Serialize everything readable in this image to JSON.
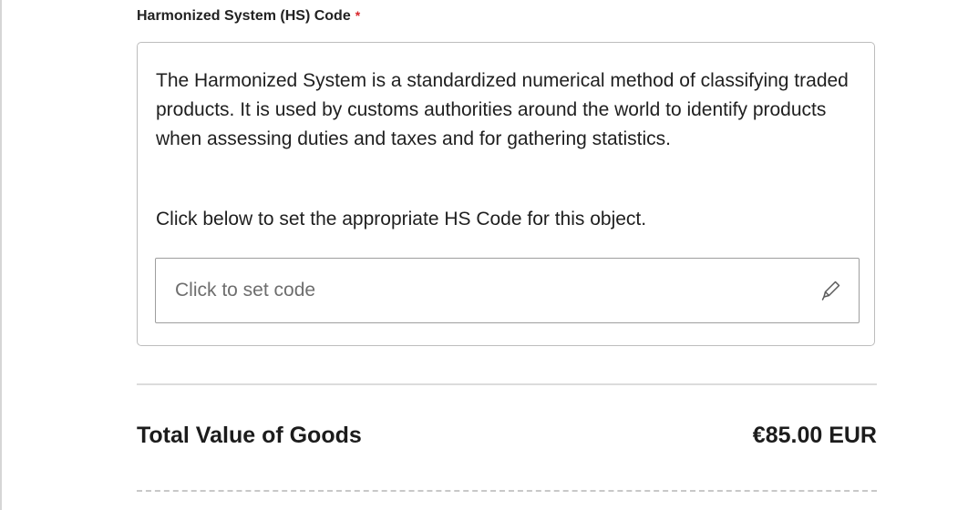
{
  "hs_field": {
    "label": "Harmonized System (HS) Code",
    "required_marker": "*",
    "description": "The Harmonized System is a standardized numerical method of classifying traded products. It is used by customs authorities around the world to identify products when assessing duties and taxes and for gathering statistics.",
    "instruction": "Click below to set the appropriate HS Code for this object.",
    "input_placeholder": "Click to set code",
    "input_icon": "pencil-icon"
  },
  "totals": {
    "label": "Total Value of Goods",
    "value": "€85.00 EUR"
  },
  "colors": {
    "required": "#d9262c",
    "text": "#1f1f1f",
    "border": "#bdbdbd"
  }
}
